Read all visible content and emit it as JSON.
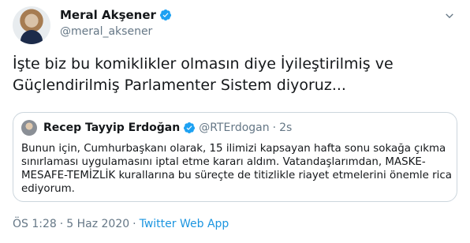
{
  "author": {
    "display_name": "Meral Akşener",
    "handle": "@meral_aksener"
  },
  "tweet": {
    "line1": "İşte biz bu komiklikler olmasın diye İyileştirilmiş ve",
    "line2": "Güçlendirilmiş Parlamenter Sistem diyoruz..."
  },
  "quoted": {
    "display_name": "Recep Tayyip Erdoğan",
    "handle": "@RTErdogan",
    "separator": "·",
    "time": "2s",
    "lines": [
      "Bunun için, Cumhurbaşkanı olarak, 15 ilimizi kapsayan hafta sonu sokağa çıkma",
      "sınırlaması uygulamasını iptal etme kararı aldım. Vatandaşlarımdan, MASKE-",
      "MESAFE-TEMİZLİK kurallarına bu süreçte de titizlikle riayet etmelerini önemle rica",
      "ediyorum."
    ]
  },
  "meta": {
    "time": "ÖS 1:28",
    "separator1": "·",
    "date": "5 Haz 2020",
    "separator2": "·",
    "source": "Twitter Web App"
  },
  "colors": {
    "verified": "#1da1f2",
    "link": "#1b95e0",
    "muted": "#657786",
    "border": "#ccd6dd"
  },
  "icons": [
    "verified-badge-icon",
    "chevron-down-icon"
  ]
}
